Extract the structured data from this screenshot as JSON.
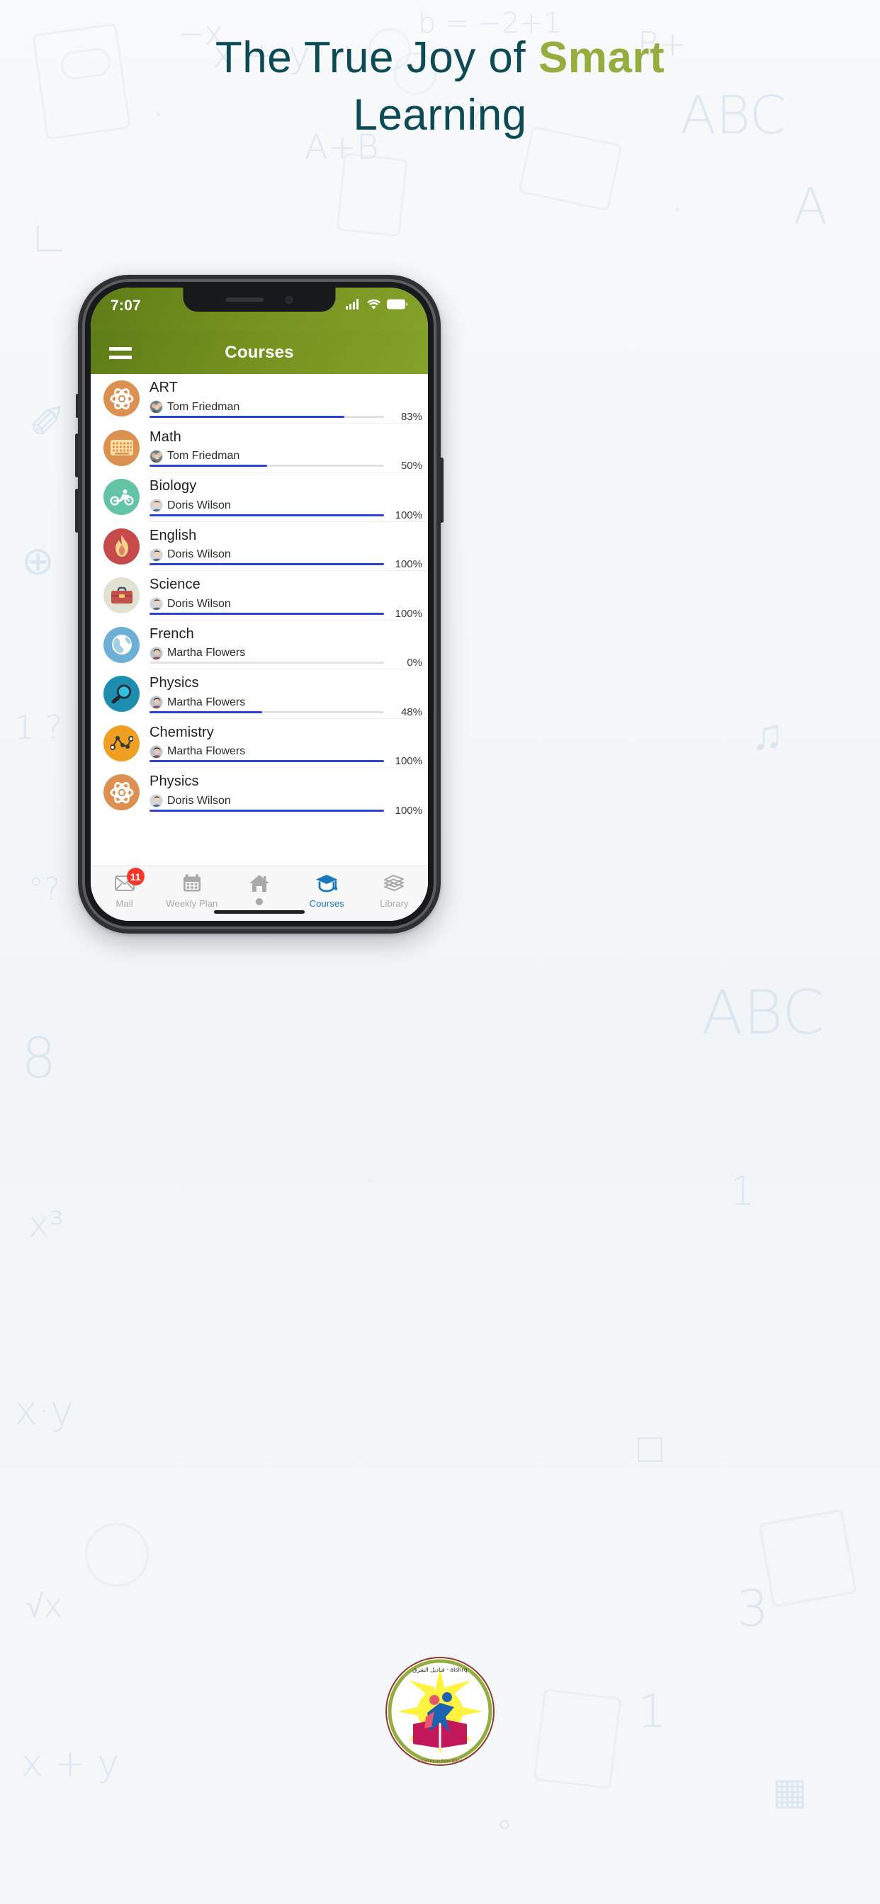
{
  "headline": {
    "line1_prefix": "The True Joy of ",
    "line1_accent": "Smart",
    "line2": "Learning",
    "color_dark": "#0d4a55",
    "color_accent": "#93ad3f"
  },
  "phone": {
    "status_bar": {
      "time": "7:07",
      "icons": [
        "cellular-signal-icon",
        "wifi-icon",
        "battery-icon"
      ]
    },
    "app_bar": {
      "menu_icon": "hamburger-menu-icon",
      "title": "Courses",
      "background_color": "#75921f"
    },
    "courses": [
      {
        "title": "ART",
        "teacher": "Tom Friedman",
        "percent": 83,
        "percent_label": "83%",
        "icon": "atom-icon",
        "icon_bg": "#dd9150",
        "icon_fg": "#ffffff"
      },
      {
        "title": "Math",
        "teacher": "Tom Friedman",
        "percent": 50,
        "percent_label": "50%",
        "icon": "keyboard-icon",
        "icon_bg": "#dd9150",
        "icon_fg": "#fbdfa4"
      },
      {
        "title": "Biology",
        "teacher": "Doris Wilson",
        "percent": 100,
        "percent_label": "100%",
        "icon": "cyclist-icon",
        "icon_bg": "#63c3a5",
        "icon_fg": "#ffffff"
      },
      {
        "title": "English",
        "teacher": "Doris Wilson",
        "percent": 100,
        "percent_label": "100%",
        "icon": "flame-icon",
        "icon_bg": "#c74a4a",
        "icon_fg": "#f7d08a"
      },
      {
        "title": "Science",
        "teacher": "Doris Wilson",
        "percent": 100,
        "percent_label": "100%",
        "icon": "briefcase-icon",
        "icon_bg": "#e2e2d2",
        "icon_fg": "#c2504b"
      },
      {
        "title": "French",
        "teacher": "Martha Flowers",
        "percent": 0,
        "percent_label": "0%",
        "icon": "globe-icon",
        "icon_bg": "#6cb0d8",
        "icon_fg": "#ffffff"
      },
      {
        "title": "Physics",
        "teacher": "Martha Flowers",
        "percent": 48,
        "percent_label": "48%",
        "icon": "magnifier-icon",
        "icon_bg": "#1d8eb0",
        "icon_fg": "#2ec3e0"
      },
      {
        "title": "Chemistry",
        "teacher": "Martha Flowers",
        "percent": 100,
        "percent_label": "100%",
        "icon": "line-chart-icon",
        "icon_bg": "#ef9f21",
        "icon_fg": "#ffffff"
      },
      {
        "title": "Physics",
        "teacher": "Doris Wilson",
        "percent": 100,
        "percent_label": "100%",
        "icon": "atom-icon",
        "icon_bg": "#dd9150",
        "icon_fg": "#ffffff"
      }
    ],
    "progress_color": "#2b43d4",
    "bottom_nav": {
      "items": [
        {
          "label": "Mail",
          "icon": "envelope-icon",
          "badge": "11",
          "active": false
        },
        {
          "label": "Weekly Plan",
          "icon": "calendar-icon",
          "badge": "",
          "active": false
        },
        {
          "label": "",
          "icon": "home-icon",
          "badge": "",
          "active": false
        },
        {
          "label": "Courses",
          "icon": "graduation-cap-icon",
          "badge": "",
          "active": true
        },
        {
          "label": "Library",
          "icon": "books-icon",
          "badge": "",
          "active": false
        }
      ],
      "active_color": "#1878be",
      "inactive_color": "#a9a9a9",
      "badge_color": "#f5372a"
    }
  },
  "footer": {
    "logo_name": "qanadeel-alshrq-logo",
    "logo_text_latin": "Qanadeel alshrq",
    "logo_text_arabic": "قناديل الشرق"
  }
}
